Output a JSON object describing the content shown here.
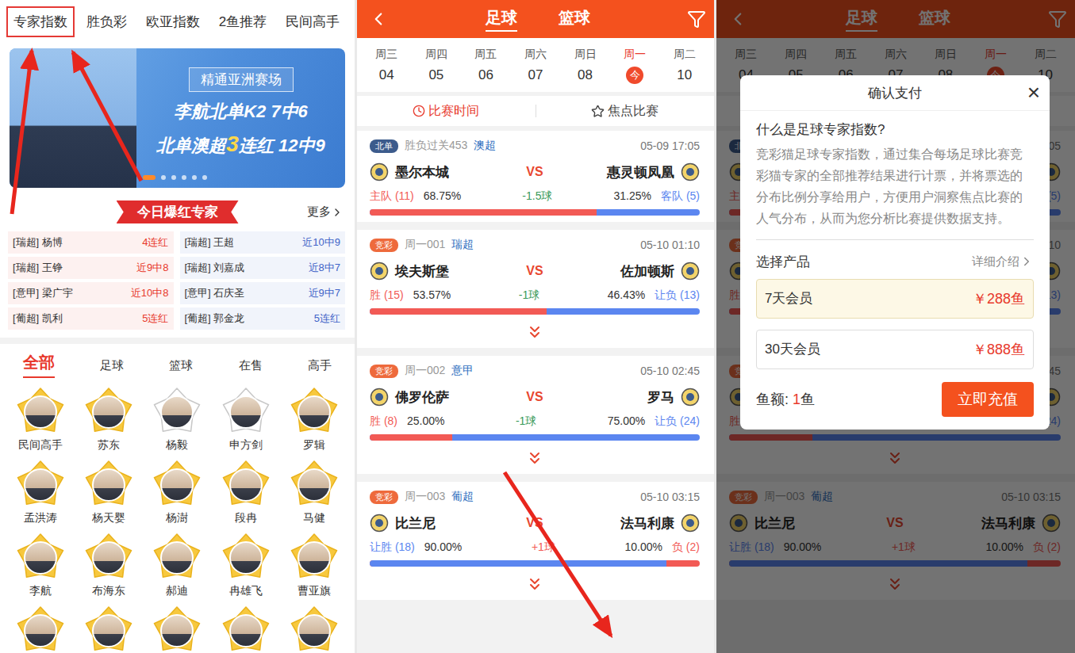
{
  "expert_page": {
    "top_tabs": [
      {
        "label": "专家指数",
        "selected": true
      },
      {
        "label": "胜负彩",
        "selected": false
      },
      {
        "label": "欧亚指数",
        "selected": false
      },
      {
        "label": "2鱼推荐",
        "selected": false
      },
      {
        "label": "民间高手",
        "selected": false
      }
    ],
    "banner": {
      "badge": "精通亚洲赛场",
      "line1": "李航北单K2 7中6",
      "line2": [
        {
          "text": "北单澳超",
          "highlight": false
        },
        {
          "text": "3",
          "highlight": true
        },
        {
          "text": "连红 12中9",
          "highlight": false
        }
      ],
      "dots": [
        {
          "selected": true
        },
        {
          "selected": false
        },
        {
          "selected": false
        },
        {
          "selected": false
        },
        {
          "selected": false
        },
        {
          "selected": false
        }
      ]
    },
    "hot": {
      "title": "今日爆红专家",
      "more": "更多",
      "experts": [
        {
          "league": "[瑞超]",
          "name": "杨博",
          "record": "4连红",
          "color": "#e8392c"
        },
        {
          "league": "[瑞超]",
          "name": "王超",
          "record": "近10中9",
          "color": "#3f63c8"
        },
        {
          "league": "[瑞超]",
          "name": "王铮",
          "record": "近9中8",
          "color": "#e8392c"
        },
        {
          "league": "[瑞超]",
          "name": "刘嘉成",
          "record": "近8中7",
          "color": "#3f63c8"
        },
        {
          "league": "[意甲]",
          "name": "梁广宇",
          "record": "近10中8",
          "color": "#e8392c"
        },
        {
          "league": "[意甲]",
          "name": "石庆圣",
          "record": "近9中7",
          "color": "#3f63c8"
        },
        {
          "league": "[葡超]",
          "name": "凯利",
          "record": "5连红",
          "color": "#e8392c"
        },
        {
          "league": "[葡超]",
          "name": "郭金龙",
          "record": "5连红",
          "color": "#3f63c8"
        }
      ]
    },
    "category_tabs": [
      {
        "label": "全部",
        "selected": true
      },
      {
        "label": "足球",
        "selected": false
      },
      {
        "label": "篮球",
        "selected": false
      },
      {
        "label": "在售",
        "selected": false
      },
      {
        "label": "高手",
        "selected": false
      }
    ],
    "experts": [
      {
        "name": "民间高手",
        "badge": "gold"
      },
      {
        "name": "苏东",
        "badge": "gold"
      },
      {
        "name": "杨毅",
        "badge": "silver"
      },
      {
        "name": "申方剑",
        "badge": "silver"
      },
      {
        "name": "罗辑",
        "badge": "gold"
      },
      {
        "name": "孟洪涛",
        "badge": "gold"
      },
      {
        "name": "杨天婴",
        "badge": "gold"
      },
      {
        "name": "杨澍",
        "badge": "gold"
      },
      {
        "name": "段冉",
        "badge": "gold"
      },
      {
        "name": "马健",
        "badge": "gold"
      },
      {
        "name": "李航",
        "badge": "gold"
      },
      {
        "name": "布海东",
        "badge": "gold"
      },
      {
        "name": "郝迪",
        "badge": "gold"
      },
      {
        "name": "冉雄飞",
        "badge": "gold"
      },
      {
        "name": "曹亚旗",
        "badge": "gold"
      },
      {
        "badge": "gold"
      },
      {
        "badge": "gold"
      },
      {
        "badge": "gold"
      },
      {
        "badge": "gold"
      },
      {
        "badge": "gold"
      }
    ]
  },
  "match_page": {
    "sports": [
      {
        "label": "足球",
        "selected": true
      },
      {
        "label": "篮球",
        "selected": false
      }
    ],
    "dates": [
      {
        "day": "周三",
        "date": "04",
        "selected": false
      },
      {
        "day": "周四",
        "date": "05",
        "selected": false
      },
      {
        "day": "周五",
        "date": "06",
        "selected": false
      },
      {
        "day": "周六",
        "date": "07",
        "selected": false
      },
      {
        "day": "周日",
        "date": "08",
        "selected": false
      },
      {
        "day": "周一",
        "date": "今",
        "selected": true
      },
      {
        "day": "周二",
        "date": "10",
        "selected": false
      }
    ],
    "sort_tabs": [
      {
        "label": "比赛时间",
        "selected": true
      },
      {
        "label": "焦点比赛",
        "selected": false
      }
    ],
    "matches": [
      {
        "tag": "北单",
        "tag_color": "#3c5b8c",
        "info": "胜负过关453",
        "league": "澳超",
        "time": "05-09 17:05",
        "home": "墨尔本城",
        "vs": "VS",
        "away": "惠灵顿凤凰",
        "left": {
          "label": "主队 (11)",
          "percent": "68.75%",
          "color": "#f25a55"
        },
        "handicap": "-1.5球",
        "handicap_color": "#3a9a5a",
        "right": {
          "label": "客队 (5)",
          "percent": "31.25%",
          "color": "#5b86f0"
        },
        "level": 0.6875,
        "expandable": false
      },
      {
        "tag": "竞彩",
        "tag_color": "#ee6a3c",
        "info": "周一001",
        "league": "瑞超",
        "time": "05-10 01:10",
        "home": "埃夫斯堡",
        "vs": "VS",
        "away": "佐加顿斯",
        "left": {
          "label": "胜 (15)",
          "percent": "53.57%",
          "color": "#f25a55"
        },
        "handicap": "-1球",
        "handicap_color": "#3a9a5a",
        "right": {
          "label": "让负 (13)",
          "percent": "46.43%",
          "color": "#5b86f0"
        },
        "level": 0.5357,
        "expandable": true
      },
      {
        "tag": "竞彩",
        "tag_color": "#ee6a3c",
        "info": "周一002",
        "league": "意甲",
        "time": "05-10 02:45",
        "home": "佛罗伦萨",
        "vs": "VS",
        "away": "罗马",
        "left": {
          "label": "胜 (8)",
          "percent": "25.00%",
          "color": "#f25a55"
        },
        "handicap": "-1球",
        "handicap_color": "#3a9a5a",
        "right": {
          "label": "让负 (24)",
          "percent": "75.00%",
          "color": "#5b86f0"
        },
        "level": 0.25,
        "expandable": true
      },
      {
        "tag": "竞彩",
        "tag_color": "#ee6a3c",
        "info": "周一003",
        "league": "葡超",
        "time": "05-10 03:15",
        "home": "比兰尼",
        "vs": "VS",
        "away": "法马利康",
        "left": {
          "label": "让胜 (18)",
          "percent": "90.00%",
          "color": "#5b86f0"
        },
        "handicap": "+1球",
        "handicap_color": "#f25a55",
        "right": {
          "label": "负 (2)",
          "percent": "10.00%",
          "color": "#f25a55"
        },
        "level": 0.9,
        "expandable": true
      }
    ]
  },
  "payment_dialog": {
    "title": "确认支付",
    "close": "×",
    "question": "什么是足球专家指数?",
    "description": "竞彩猫足球专家指数，通过集合每场足球比赛竞彩猫专家的全部推荐结果进行计票，并将票选的分布比例分享给用户，方便用户洞察焦点比赛的人气分布，从而为您分析比赛提供数据支持。",
    "products_label": "选择产品",
    "details": "详细介绍",
    "products": [
      {
        "name": "7天会员",
        "price": "￥288鱼",
        "selected": true
      },
      {
        "name": "30天会员",
        "price": "￥888鱼",
        "selected": false
      }
    ],
    "balance_label": "鱼额:",
    "balance_value": "1",
    "balance_unit": "鱼",
    "button": "立即充值"
  }
}
